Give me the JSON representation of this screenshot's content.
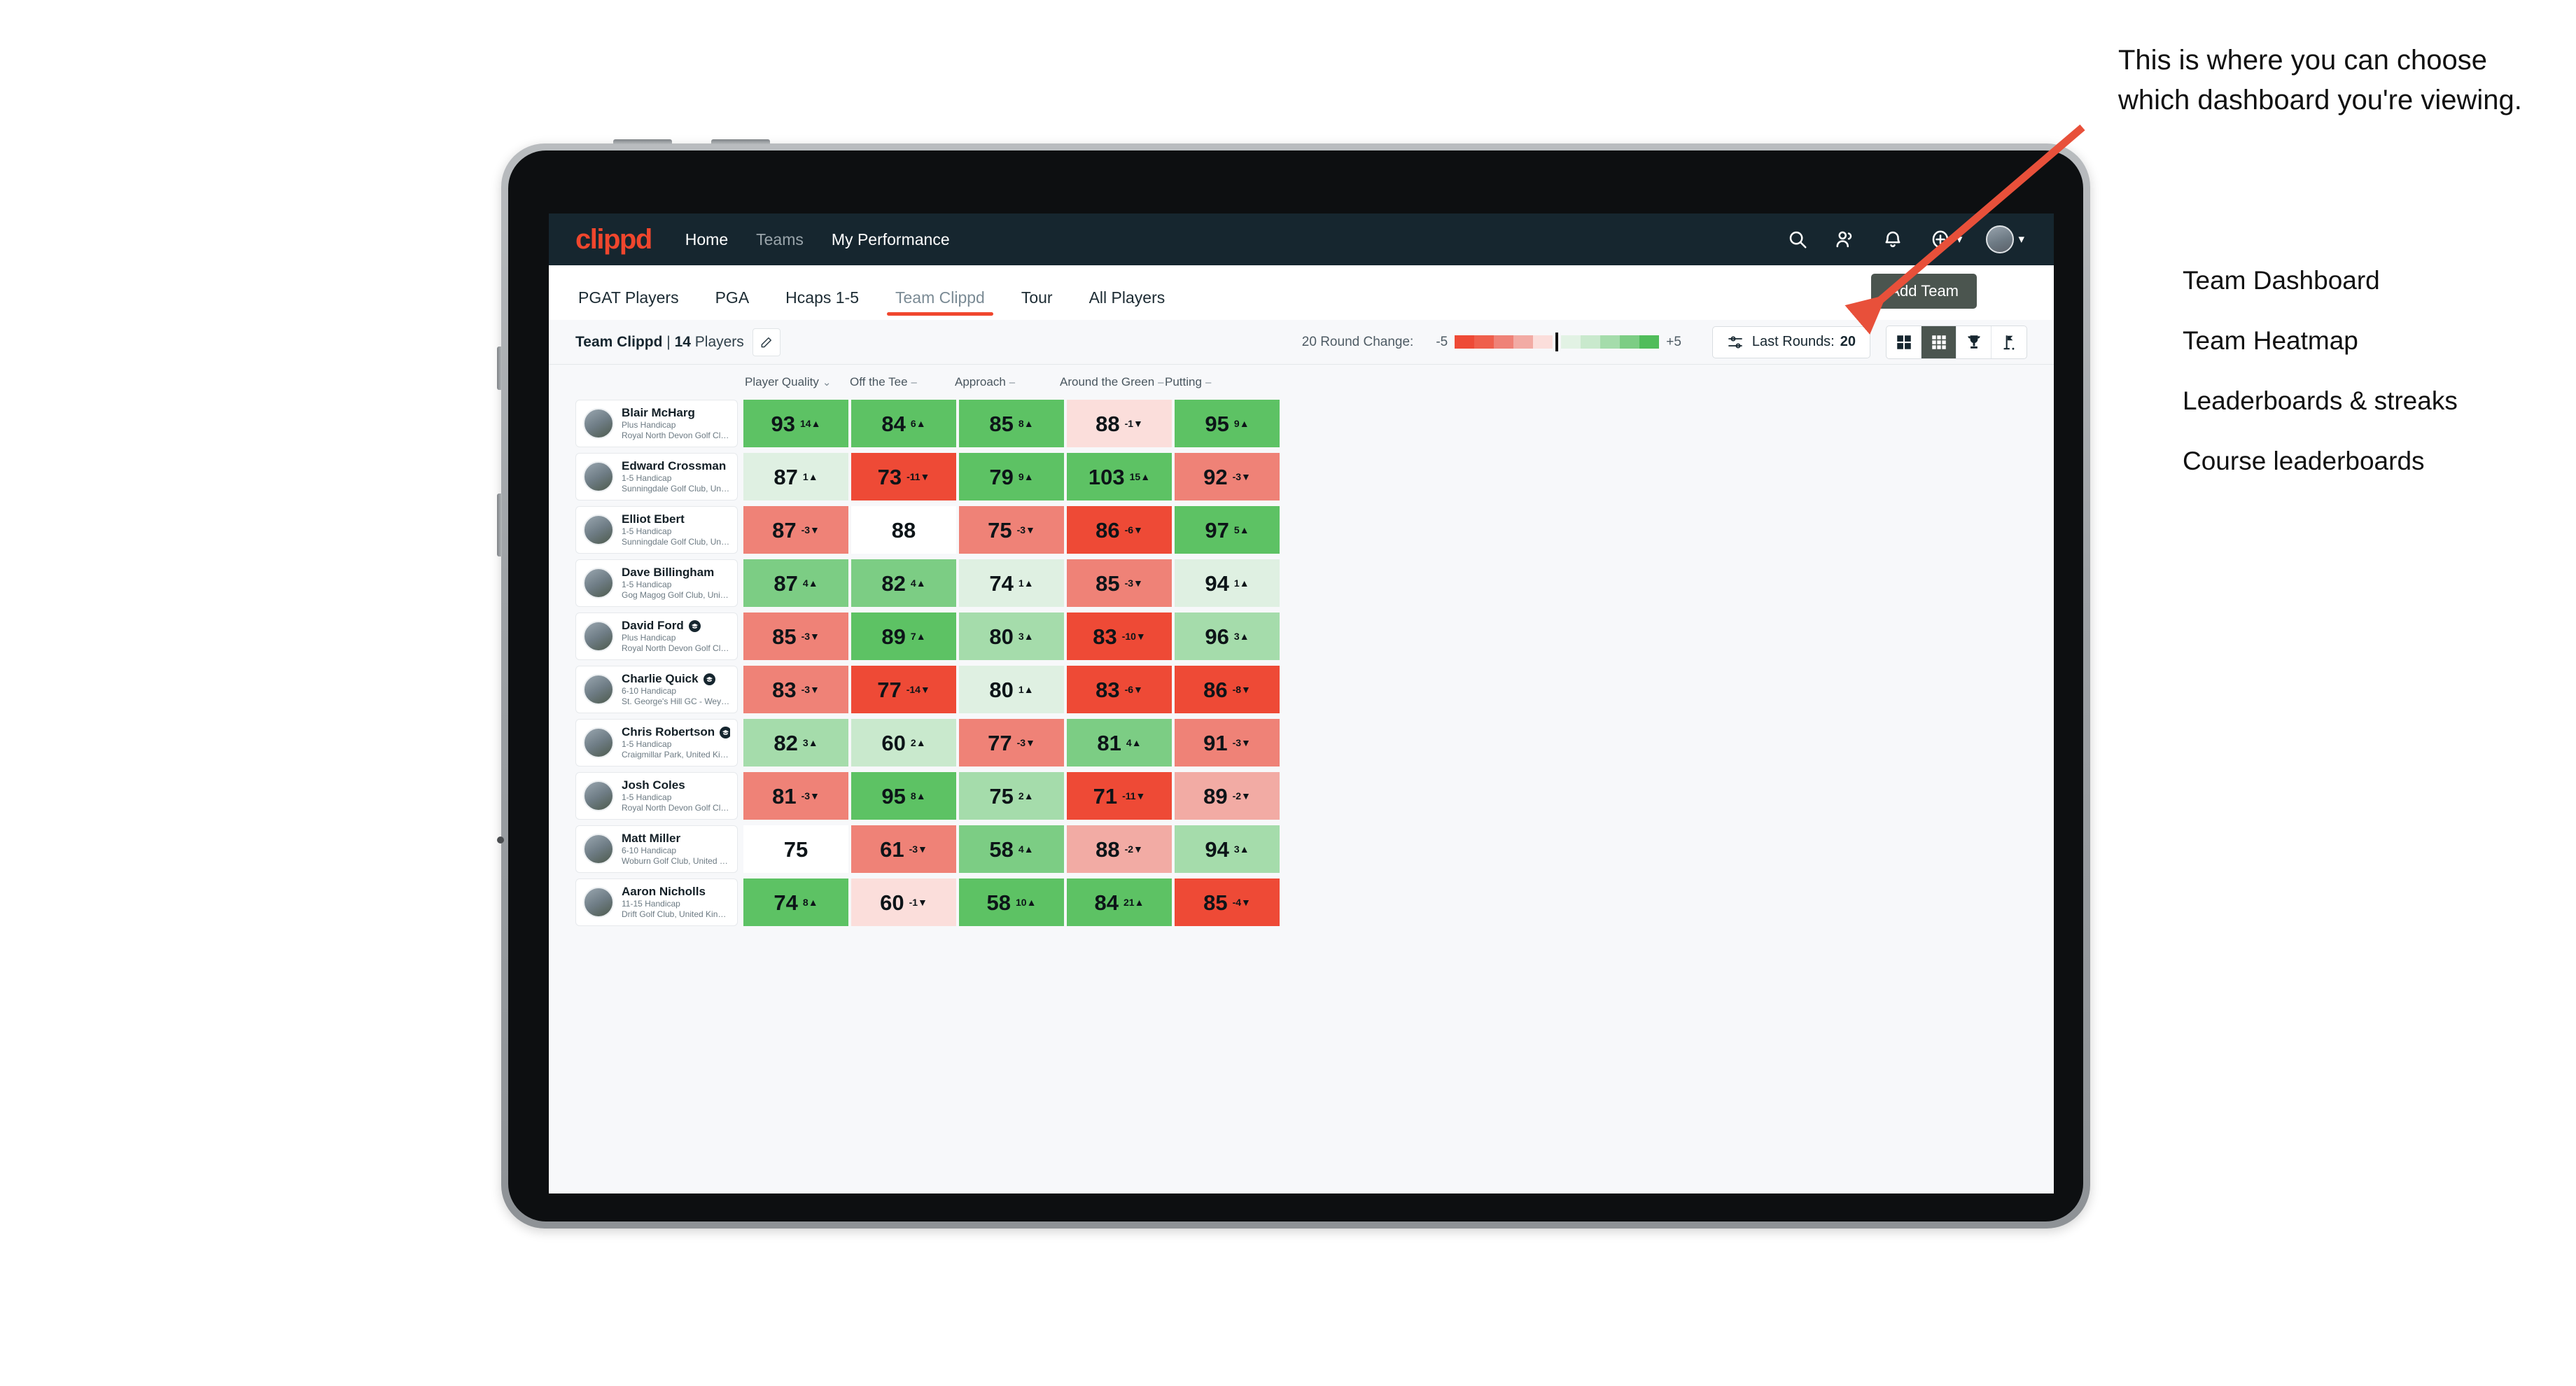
{
  "brand": {
    "logo_text": "clippd",
    "accent": "#f0462d",
    "navbar_bg": "#16262f"
  },
  "topnav": {
    "links": [
      {
        "label": "Home",
        "dim": false
      },
      {
        "label": "Teams",
        "dim": true
      },
      {
        "label": "My Performance",
        "dim": false
      }
    ],
    "icons": [
      "search-icon",
      "people-icon",
      "bell-icon",
      "plus-circle-icon"
    ]
  },
  "tabs": [
    {
      "label": "PGAT Players",
      "active": false
    },
    {
      "label": "PGA",
      "active": false
    },
    {
      "label": "Hcaps 1-5",
      "active": false
    },
    {
      "label": "Team Clippd",
      "active": true
    },
    {
      "label": "Tour",
      "active": false
    },
    {
      "label": "All Players",
      "active": false
    }
  ],
  "add_team_label": "Add Team",
  "toolbar": {
    "team_name": "Team Clippd",
    "team_separator": " | ",
    "player_count": "14",
    "players_word": " Players",
    "legend_title": "20 Round Change:",
    "legend_min": "-5",
    "legend_max": "+5",
    "legend_red": [
      "#ee4a36",
      "#ef5f4c",
      "#ef8277",
      "#f2aba4",
      "#fbdedb"
    ],
    "legend_green": [
      "#e2f2e4",
      "#c9e9cd",
      "#a5dcab",
      "#7ccd84",
      "#50bd5b"
    ],
    "rounds_label": "Last Rounds:",
    "rounds_value": "20",
    "view_buttons": [
      {
        "name": "grid-2x2-icon",
        "selected": false
      },
      {
        "name": "grid-3x3-icon",
        "selected": true
      },
      {
        "name": "trophy-icon",
        "selected": false
      },
      {
        "name": "golf-flag-icon",
        "selected": false
      }
    ]
  },
  "columns": [
    {
      "label": "Player Quality",
      "mark": "chevron-down"
    },
    {
      "label": "Off the Tee",
      "mark": "dash"
    },
    {
      "label": "Approach",
      "mark": "dash"
    },
    {
      "label": "Around the Green",
      "mark": "dash"
    },
    {
      "label": "Putting",
      "mark": "dash"
    }
  ],
  "chart_data": {
    "type": "heatmap",
    "title": "Team Clippd — Player Quality Heatmap",
    "categories": [
      "Player Quality",
      "Off the Tee",
      "Approach",
      "Around the Green",
      "Putting"
    ],
    "legend": {
      "label": "20 Round Change",
      "min": -5,
      "max": 5
    },
    "rows": [
      {
        "player": "Blair McHarg",
        "handicap": "Plus Handicap",
        "club": "Royal North Devon Golf Club, United Kingdom",
        "badge": false,
        "values": [
          93,
          84,
          85,
          88,
          95
        ],
        "deltas": [
          14,
          6,
          8,
          -1,
          9
        ],
        "colors": [
          "#5dc264",
          "#5dc264",
          "#5dc264",
          "#fbdedb",
          "#5dc264"
        ]
      },
      {
        "player": "Edward Crossman",
        "handicap": "1-5 Handicap",
        "club": "Sunningdale Golf Club, United Kingdom",
        "badge": false,
        "values": [
          87,
          73,
          79,
          103,
          92
        ],
        "deltas": [
          1,
          -11,
          9,
          15,
          -3
        ],
        "colors": [
          "#dff0e2",
          "#ee4a36",
          "#5dc264",
          "#5dc264",
          "#ef8277"
        ]
      },
      {
        "player": "Elliot Ebert",
        "handicap": "1-5 Handicap",
        "club": "Sunningdale Golf Club, United Kingdom",
        "badge": false,
        "values": [
          87,
          88,
          75,
          86,
          97
        ],
        "deltas": [
          -3,
          null,
          -3,
          -6,
          5
        ],
        "colors": [
          "#ef8277",
          "#ffffff",
          "#ef8277",
          "#ee4a36",
          "#5dc264"
        ]
      },
      {
        "player": "Dave Billingham",
        "handicap": "1-5 Handicap",
        "club": "Gog Magog Golf Club, United Kingdom",
        "badge": false,
        "values": [
          87,
          82,
          74,
          85,
          94
        ],
        "deltas": [
          4,
          4,
          1,
          -3,
          1
        ],
        "colors": [
          "#7ccd84",
          "#7ccd84",
          "#dff0e2",
          "#ef8277",
          "#dff0e2"
        ]
      },
      {
        "player": "David Ford",
        "handicap": "Plus Handicap",
        "club": "Royal North Devon Golf Club, United Kingdom",
        "badge": true,
        "values": [
          85,
          89,
          80,
          83,
          96
        ],
        "deltas": [
          -3,
          7,
          3,
          -10,
          3
        ],
        "colors": [
          "#ef8277",
          "#5dc264",
          "#a5dcab",
          "#ee4a36",
          "#a5dcab"
        ]
      },
      {
        "player": "Charlie Quick",
        "handicap": "6-10 Handicap",
        "club": "St. George's Hill GC - Weybridge - Surrey, Uni...",
        "badge": true,
        "values": [
          83,
          77,
          80,
          83,
          86
        ],
        "deltas": [
          -3,
          -14,
          1,
          -6,
          -8
        ],
        "colors": [
          "#ef8277",
          "#ee4a36",
          "#dff0e2",
          "#ee4a36",
          "#ee4a36"
        ]
      },
      {
        "player": "Chris Robertson",
        "handicap": "1-5 Handicap",
        "club": "Craigmillar Park, United Kingdom",
        "badge": true,
        "values": [
          82,
          60,
          77,
          81,
          91
        ],
        "deltas": [
          3,
          2,
          -3,
          4,
          -3
        ],
        "colors": [
          "#a5dcab",
          "#c9e9cd",
          "#ef8277",
          "#7ccd84",
          "#ef8277"
        ]
      },
      {
        "player": "Josh Coles",
        "handicap": "1-5 Handicap",
        "club": "Royal North Devon Golf Club, United Kingdom",
        "badge": false,
        "values": [
          81,
          95,
          75,
          71,
          89
        ],
        "deltas": [
          -3,
          8,
          2,
          -11,
          -2
        ],
        "colors": [
          "#ef8277",
          "#5dc264",
          "#a5dcab",
          "#ee4a36",
          "#f2aba4"
        ]
      },
      {
        "player": "Matt Miller",
        "handicap": "6-10 Handicap",
        "club": "Woburn Golf Club, United Kingdom",
        "badge": false,
        "values": [
          75,
          61,
          58,
          88,
          94
        ],
        "deltas": [
          null,
          -3,
          4,
          -2,
          3
        ],
        "colors": [
          "#ffffff",
          "#ef8277",
          "#7ccd84",
          "#f2aba4",
          "#a5dcab"
        ]
      },
      {
        "player": "Aaron Nicholls",
        "handicap": "11-15 Handicap",
        "club": "Drift Golf Club, United Kingdom",
        "badge": false,
        "values": [
          74,
          60,
          58,
          84,
          85
        ],
        "deltas": [
          8,
          -1,
          10,
          21,
          -4
        ],
        "colors": [
          "#5dc264",
          "#fbdedb",
          "#5dc264",
          "#5dc264",
          "#ee4a36"
        ]
      }
    ]
  },
  "annotation": {
    "callout": "This is where you can choose which dashboard you're viewing.",
    "options": [
      "Team Dashboard",
      "Team Heatmap",
      "Leaderboards & streaks",
      "Course leaderboards"
    ],
    "arrow_color": "#e8503a"
  }
}
